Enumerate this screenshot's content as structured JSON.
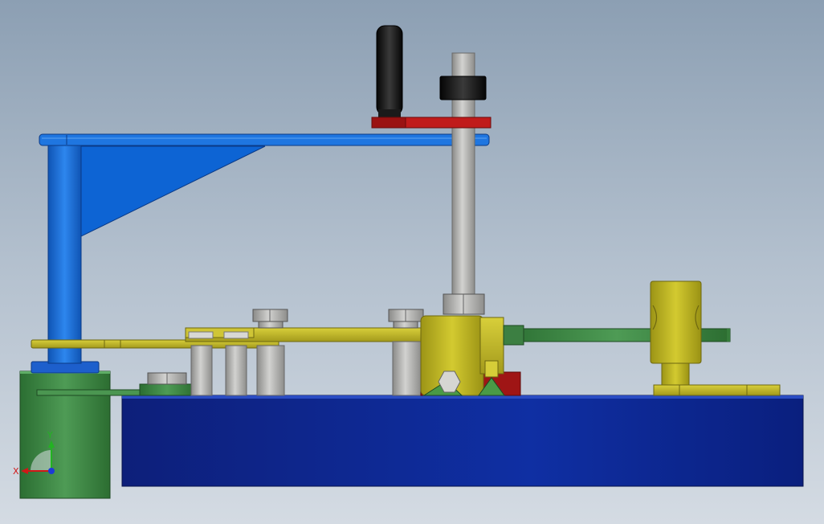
{
  "viewport": {
    "colors": {
      "background_top": "#8c9fb3",
      "background_bottom": "#d4dbe3",
      "blue_frame": "#1c6fd6",
      "base_plate": "#0d2e9e",
      "brass": "#c9bf2c",
      "green_part": "#3f8a45",
      "steel": "#a8a8a6",
      "red_part": "#b01818",
      "black_knob": "#151515"
    }
  },
  "triad": {
    "x_label": "X",
    "y_label": "Y",
    "x_color": "#d01818",
    "y_color": "#22b322",
    "z_color": "#1d3ad6"
  }
}
